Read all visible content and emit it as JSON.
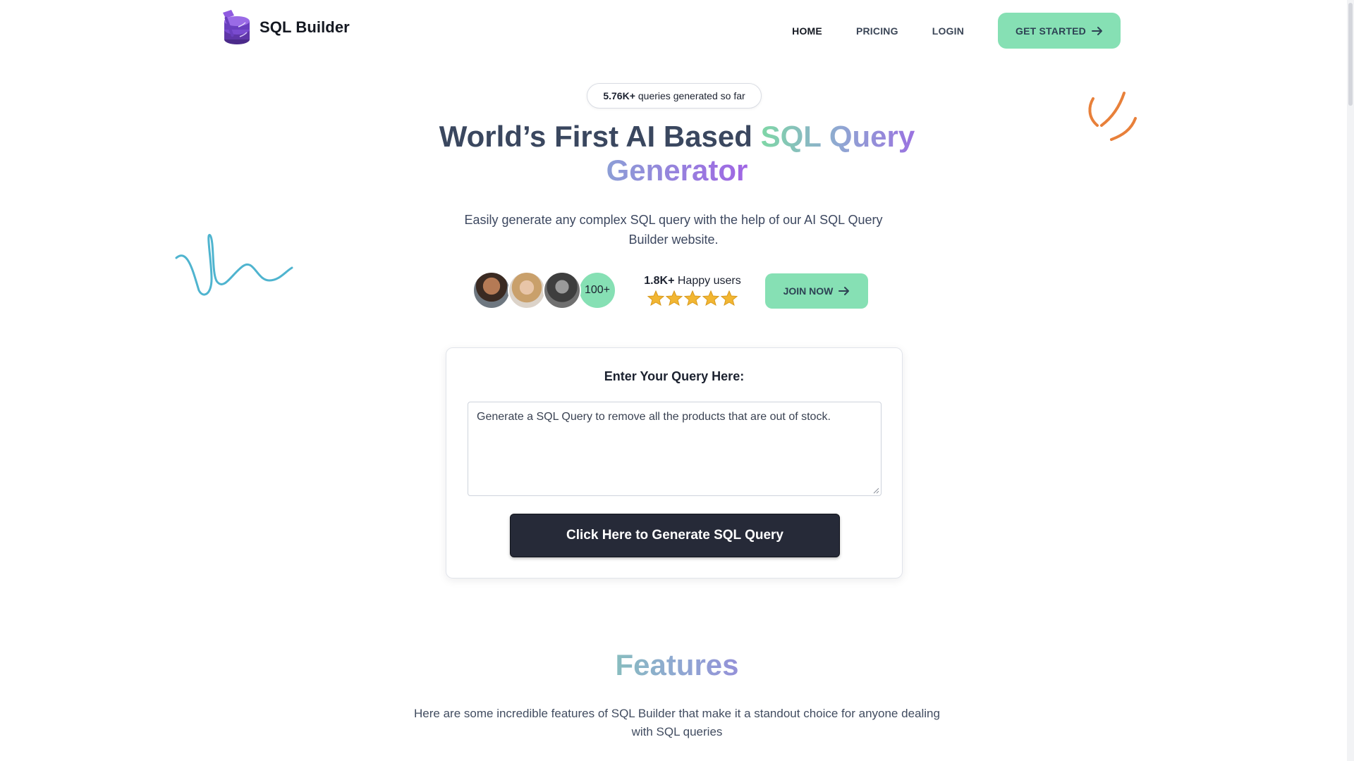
{
  "brand": {
    "name": "SQL Builder",
    "logo_icon": "database-hammer-logo"
  },
  "nav": {
    "items": [
      {
        "label": "HOME",
        "active": true
      },
      {
        "label": "PRICING",
        "active": false
      },
      {
        "label": "LOGIN",
        "active": false
      }
    ],
    "cta_label": "GET STARTED"
  },
  "hero": {
    "counter_value": "5.76K+",
    "counter_text": "queries generated so far",
    "title_part1": "World’s First AI Based ",
    "title_highlight": "SQL Query",
    "title_part2": "Generator",
    "subtitle": "Easily generate any complex SQL query with the help of our AI SQL Query Builder website."
  },
  "social_proof": {
    "avatar_more": "100+",
    "users_value": "1.8K+",
    "users_text": "Happy users",
    "stars": 5,
    "join_label": "JOIN NOW"
  },
  "query_card": {
    "label": "Enter Your Query Here:",
    "query_text": "Generate a SQL Query to remove all the products that are out of stock.",
    "generate_label": "Click Here to Generate SQL Query"
  },
  "features": {
    "title": "Features",
    "subtitle": "Here are some incredible features of SQL Builder that make it a standout choice for anyone dealing with SQL queries"
  },
  "colors": {
    "accent_green": "#86e0b4",
    "dark_button": "#262a38",
    "star": "#f2b632",
    "squiggle_blue": "#4fb4cf",
    "squiggle_orange": "#e8803a"
  }
}
